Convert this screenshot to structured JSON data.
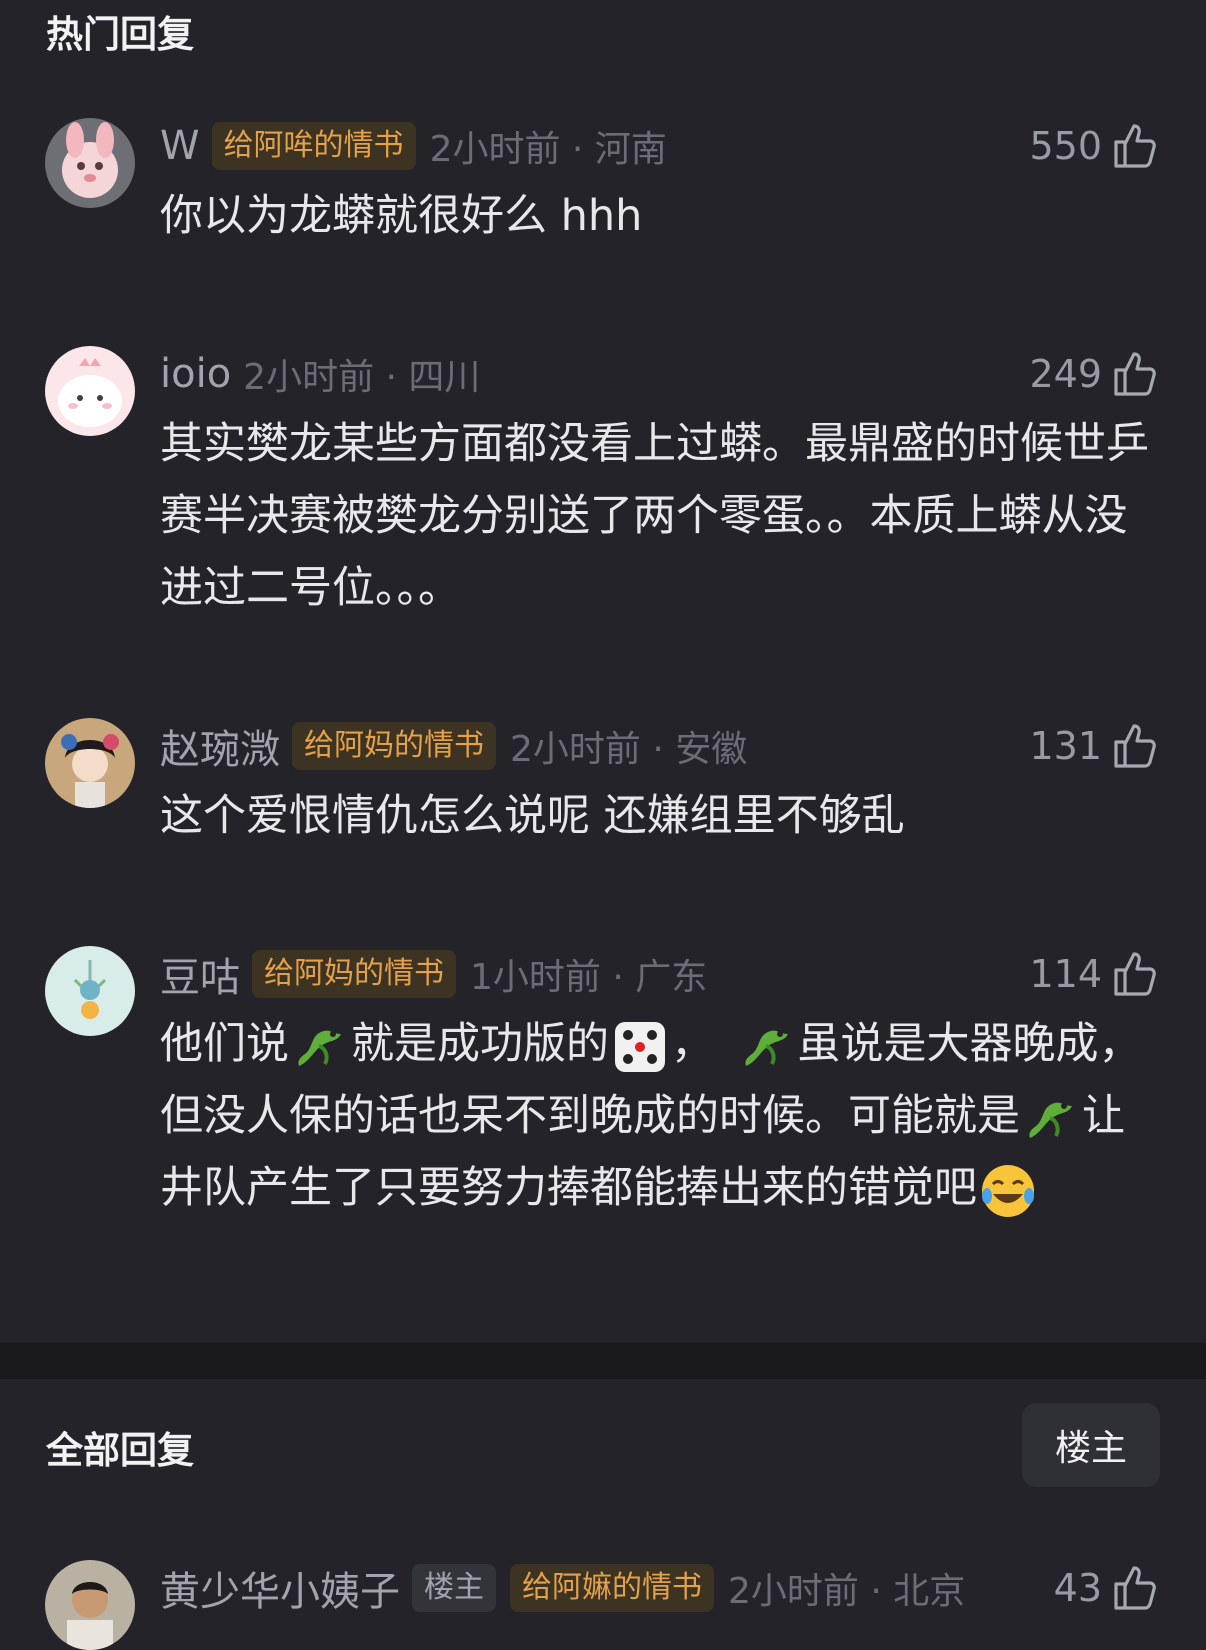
{
  "hot_section": {
    "title": "热门回复"
  },
  "all_section": {
    "title": "全部回复",
    "filter_label": "楼主"
  },
  "colors": {
    "background": "#232329",
    "tag_text": "#e3a14a",
    "tag_bg": "#3d3322"
  },
  "comments": [
    {
      "username": "W",
      "tag": "给阿哞的情书",
      "time_location": "2小时前 · 河南",
      "likes": "550",
      "text_parts": [
        "你以为龙蟒就很好么 hhh"
      ]
    },
    {
      "username": "ioio",
      "time_location": "2小时前 · 四川",
      "likes": "249",
      "text_parts": [
        "其实樊龙某些方面都没看上过蟒。最鼎盛的时候世乒赛半决赛被樊龙分别送了两个零蛋。。本质上蟒从没进过二号位。。。"
      ]
    },
    {
      "username": "赵琬溦",
      "tag": "给阿妈的情书",
      "time_location": "2小时前 · 安徽",
      "likes": "131",
      "text_parts": [
        "这个爱恨情仇怎么说呢 还嫌组里不够乱"
      ]
    },
    {
      "username": "豆咕",
      "tag": "给阿妈的情书",
      "time_location": "1小时前 · 广东",
      "likes": "114",
      "text_parts": [
        "他们说",
        "就是成功版的",
        "，",
        "虽说是大器晚成，但没人保的话也呆不到晚成的时候。可能就是",
        "让井队产生了只要努力捧都能捧出来的错觉吧"
      ],
      "emoji_icons": [
        "dragon-emoji",
        "dice-emoji",
        "dragon-emoji",
        "dragon-emoji",
        "tears-of-joy-emoji"
      ]
    },
    {
      "username": "黄少华小姨子",
      "owner_tag": "楼主",
      "tag": "给阿嫲的情书",
      "time_location": "2小时前 · 北京",
      "likes": "43"
    }
  ]
}
